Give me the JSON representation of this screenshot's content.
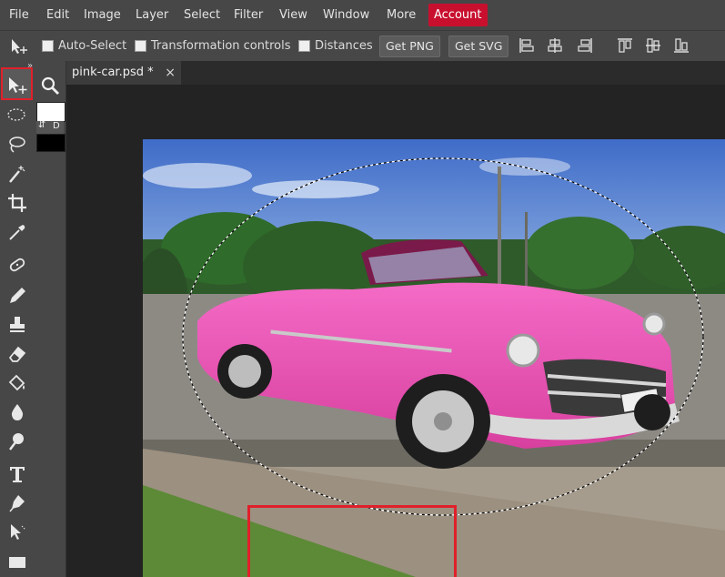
{
  "menu": {
    "items": [
      "File",
      "Edit",
      "Image",
      "Layer",
      "Select",
      "Filter",
      "View",
      "Window",
      "More"
    ],
    "account": "Account",
    "account_color": "#c8102e"
  },
  "options": {
    "auto_select": "Auto-Select",
    "transformation_controls": "Transformation controls",
    "distances": "Distances",
    "get_png": "Get PNG",
    "get_svg": "Get SVG",
    "align_icons": [
      "align-left-icon",
      "align-center-h-icon",
      "align-right-icon",
      "align-top-icon",
      "align-middle-v-icon",
      "align-bottom-icon"
    ]
  },
  "tab": {
    "title": "pink-car.psd *",
    "close": "×"
  },
  "tools": {
    "swap": "⇵",
    "default": "D",
    "collapse": "»"
  },
  "highlight_color": "#e0202a"
}
